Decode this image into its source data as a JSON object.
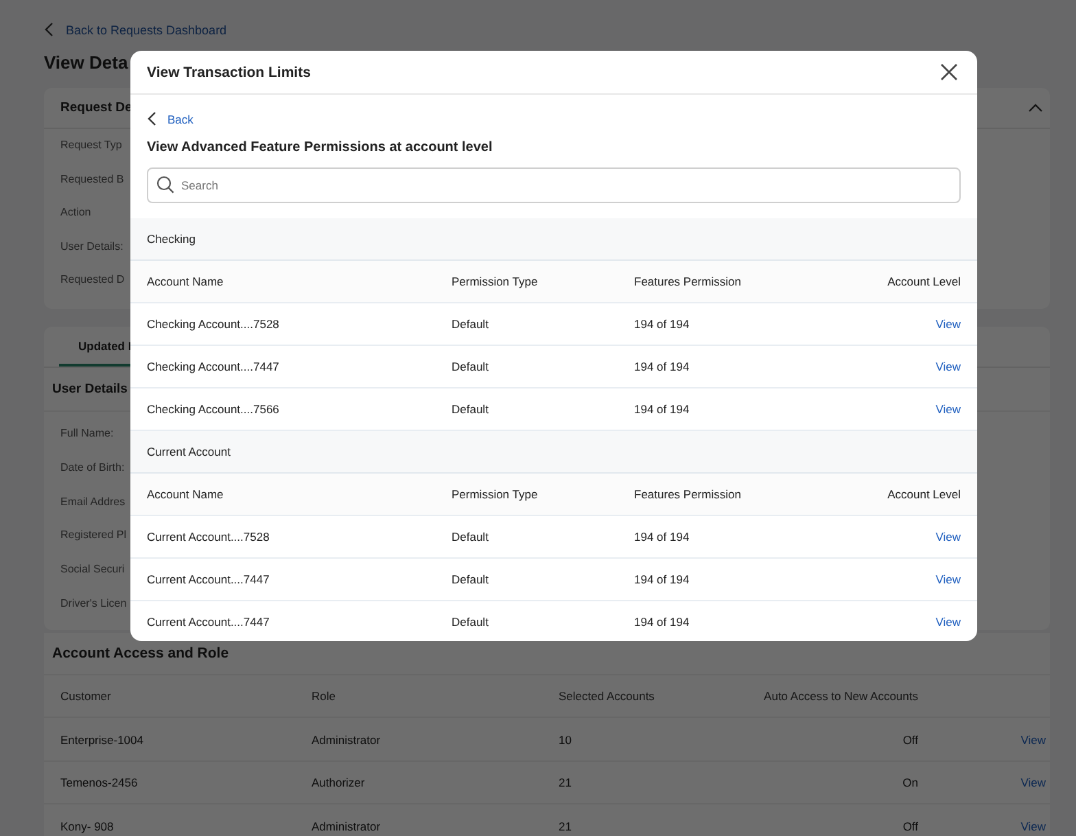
{
  "page": {
    "back_link": "Back to Requests Dashboard",
    "title": "View Deta",
    "request_card": {
      "title": "Request De",
      "expanded": true,
      "fields": [
        "Request Typ",
        "Requested B",
        "Action",
        "User Details:",
        "Requested D"
      ]
    },
    "tabs": [
      {
        "label": "Updated I",
        "selected": true
      }
    ],
    "user_details": {
      "title": "User Details",
      "fields": [
        "Full Name:",
        "Date of Birth:",
        "Email Addres",
        "Registered Pl",
        "Social Securi",
        "Driver's Licen"
      ]
    },
    "account_access": {
      "title": "Account Access and Role",
      "columns": [
        "Customer",
        "Role",
        "Selected Accounts",
        "Auto Access to New Accounts"
      ],
      "rows": [
        {
          "customer": "Enterprise-1004",
          "role": "Administrator",
          "selected_accounts": "10",
          "auto_access": "Off",
          "action": "View"
        },
        {
          "customer": "Temenos-2456",
          "role": "Authorizer",
          "selected_accounts": "21",
          "auto_access": "On",
          "action": "View"
        },
        {
          "customer": "Kony- 908",
          "role": "Administrator",
          "selected_accounts": "21",
          "auto_access": "Off",
          "action": "View"
        }
      ]
    }
  },
  "modal": {
    "title": "View Transaction Limits",
    "back": "Back",
    "subtitle": "View Advanced Feature Permissions at account level",
    "search": {
      "placeholder": "Search"
    },
    "groups": [
      {
        "name": "Checking",
        "columns": [
          "Account Name",
          "Permission Type",
          "Features Permission",
          "Account Level"
        ],
        "rows": [
          {
            "account_name": "Checking Account....7528",
            "permission_type": "Default",
            "features_permission": "194 of 194",
            "action": "View"
          },
          {
            "account_name": "Checking Account....7447",
            "permission_type": "Default",
            "features_permission": "194 of 194",
            "action": "View"
          },
          {
            "account_name": "Checking Account....7566",
            "permission_type": "Default",
            "features_permission": "194 of 194",
            "action": "View"
          }
        ]
      },
      {
        "name": "Current Account",
        "columns": [
          "Account Name",
          "Permission Type",
          "Features Permission",
          "Account Level"
        ],
        "rows": [
          {
            "account_name": "Current Account....7528",
            "permission_type": "Default",
            "features_permission": "194 of 194",
            "action": "View"
          },
          {
            "account_name": "Current Account....7447",
            "permission_type": "Default",
            "features_permission": "194 of 194",
            "action": "View"
          },
          {
            "account_name": "Current Account....7447",
            "permission_type": "Default",
            "features_permission": "194 of 194",
            "action": "View"
          }
        ]
      }
    ]
  }
}
